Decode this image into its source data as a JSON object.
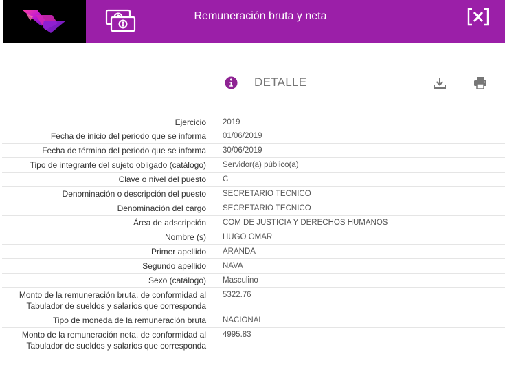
{
  "header": {
    "title": "Remuneración bruta y neta",
    "close_label": "[×]",
    "accent_color": "#9b1fa8",
    "logo_icon": "brand-logo-icon",
    "money_icon": "money-bills-icon"
  },
  "detail": {
    "title": "DETALLE",
    "info_icon": "info-icon",
    "download_icon": "download-icon",
    "print_icon": "print-icon"
  },
  "rows": [
    {
      "label": "Ejercicio",
      "value": "2019"
    },
    {
      "label": "Fecha de inicio del periodo que se informa",
      "value": "01/06/2019"
    },
    {
      "label": "Fecha de término del periodo que se informa",
      "value": "30/06/2019"
    },
    {
      "label": "Tipo de integrante del sujeto obligado (catálogo)",
      "value": "Servidor(a) público(a)"
    },
    {
      "label": "Clave o nivel del puesto",
      "value": "C"
    },
    {
      "label": "Denominación o descripción del puesto",
      "value": "SECRETARIO TECNICO"
    },
    {
      "label": "Denominación del cargo",
      "value": "SECRETARIO TECNICO"
    },
    {
      "label": "Área de adscripción",
      "value": "COM DE JUSTICIA Y DERECHOS HUMANOS"
    },
    {
      "label": "Nombre (s)",
      "value": "HUGO OMAR"
    },
    {
      "label": "Primer apellido",
      "value": "ARANDA"
    },
    {
      "label": "Segundo apellido",
      "value": "NAVA"
    },
    {
      "label": "Sexo (catálogo)",
      "value": "Masculino"
    },
    {
      "label": "Monto de la remuneración bruta, de conformidad al Tabulador de sueldos y salarios que corresponda",
      "value": "5322.76"
    },
    {
      "label": "Tipo de moneda de la remuneración bruta",
      "value": "NACIONAL"
    },
    {
      "label": "Monto de la remuneración neta, de conformidad al Tabulador de sueldos y salarios que corresponda",
      "value": "4995.83"
    }
  ]
}
